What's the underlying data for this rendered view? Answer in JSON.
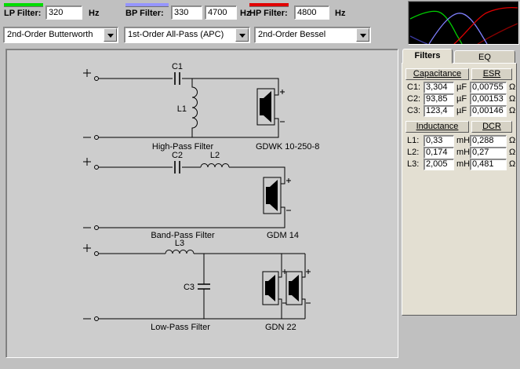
{
  "toolbar": {
    "lp": {
      "label": "LP Filter:",
      "value": "320",
      "unit": "Hz",
      "color": "#00dc00",
      "type": "2nd-Order Butterworth"
    },
    "bp": {
      "label": "BP Filter:",
      "value_low": "330",
      "value_high": "4700",
      "unit": "Hz",
      "color": "#9595ff",
      "type": "1st-Order All-Pass (APC)"
    },
    "hp": {
      "label": "HP Filter:",
      "value": "4800",
      "unit": "Hz",
      "color": "#e00000",
      "type": "2nd-Order Bessel"
    }
  },
  "graph": {
    "background": "#000000",
    "curves": [
      {
        "name": "low-pass-response",
        "color": "#00d000"
      },
      {
        "name": "band-pass-response",
        "color": "#8080ff"
      },
      {
        "name": "high-pass-response",
        "color": "#e00000"
      }
    ]
  },
  "circuits": [
    {
      "cap": "C1",
      "ind": "L1",
      "title": "High-Pass Filter",
      "speaker": "GDWK 10-250-8"
    },
    {
      "cap": "C2",
      "ind": "L2",
      "title": "Band-Pass Filter",
      "speaker": "GDM 14"
    },
    {
      "cap": "C3",
      "ind": "L3",
      "title": "Low-Pass Filter",
      "speaker": "GDN 22"
    }
  ],
  "filters_panel": {
    "tabs": {
      "filters": "Filters",
      "eq": "EQ"
    },
    "cap_header": "Capacitance",
    "esr_header": "ESR",
    "ind_header": "Inductance",
    "dcr_header": "DCR",
    "ohm": "Ω",
    "cap_rows": [
      {
        "label": "C1:",
        "value": "3,304",
        "unit": "µF",
        "esr": "0,00755"
      },
      {
        "label": "C2:",
        "value": "93,85",
        "unit": "µF",
        "esr": "0,00153"
      },
      {
        "label": "C3:",
        "value": "123,4",
        "unit": "µF",
        "esr": "0,00146"
      }
    ],
    "ind_rows": [
      {
        "label": "L1:",
        "value": "0,33",
        "unit": "mH",
        "esr": "0,288"
      },
      {
        "label": "L2:",
        "value": "0,174",
        "unit": "mH",
        "esr": "0,27"
      },
      {
        "label": "L3:",
        "value": "2,005",
        "unit": "mH",
        "esr": "0,481"
      }
    ]
  }
}
